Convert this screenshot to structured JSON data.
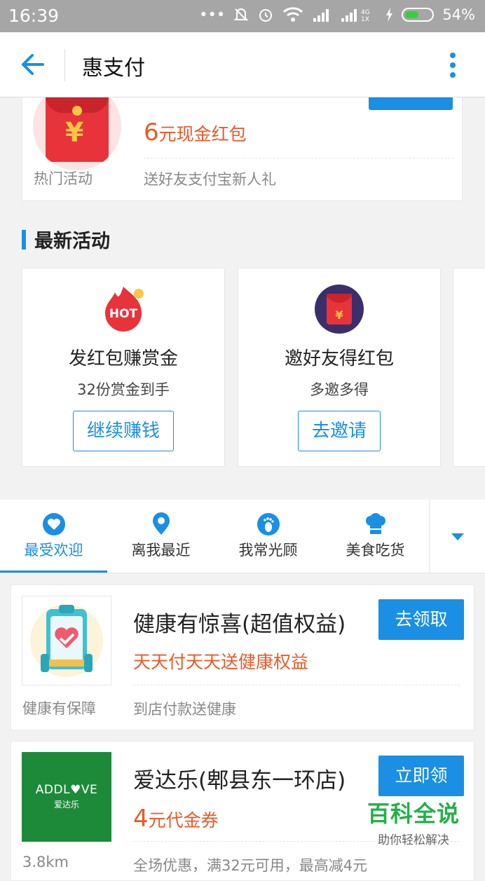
{
  "status_bar": {
    "time": "16:39",
    "battery_text": "54%",
    "battery_level": 0.54,
    "icons": [
      "more-dots-icon",
      "mute-icon",
      "alarm-icon",
      "wifi-icon",
      "signal-icon",
      "signal-4g-icon",
      "charging-icon",
      "battery-icon"
    ]
  },
  "appbar": {
    "title": "惠支付",
    "back_icon": "arrow-left-icon",
    "more_icon": "more-vertical-icon"
  },
  "hot_card": {
    "left_label": "热门活动",
    "amount_number": "6",
    "amount_text": "元现金红包",
    "description": "送好友支付宝新人礼"
  },
  "latest": {
    "section_title": "最新活动",
    "cards": [
      {
        "icon": "hot-badge-icon",
        "title": "发红包赚赏金",
        "subtitle": "32份赏金到手",
        "button": "继续赚钱"
      },
      {
        "icon": "red-envelope-icon",
        "title": "邀好友得红包",
        "subtitle": "多邀多得",
        "button": "去邀请"
      }
    ]
  },
  "tabs": {
    "items": [
      {
        "label": "最受欢迎",
        "icon": "heart-icon",
        "active": true
      },
      {
        "label": "离我最近",
        "icon": "location-pin-icon",
        "active": false
      },
      {
        "label": "我常光顾",
        "icon": "footprint-icon",
        "active": false
      },
      {
        "label": "美食吃货",
        "icon": "chef-hat-icon",
        "active": false
      }
    ],
    "expand_icon": "caret-down-icon"
  },
  "shops": [
    {
      "thumb_icon": "health-clipboard-icon",
      "title": "健康有惊喜(超值权益)",
      "action": "去领取",
      "promo": "天天付天天送健康权益",
      "left_note": "健康有保障",
      "right_note": "到店付款送健康"
    },
    {
      "thumb_text": "ADDL♥VE",
      "thumb_subtext": "爱达乐",
      "title": "爱达乐(郫县东一环店)",
      "action": "立即领",
      "promo_number": "4",
      "promo_text": "元代金券",
      "left_note": "3.8km",
      "right_note": "全场优惠，满32元可用，最高减4元"
    }
  ],
  "watermark": {
    "title": "百科全说",
    "subtitle": "助你轻松解决"
  },
  "colors": {
    "accent": "#1a8fe3",
    "promo": "#e85a28",
    "status_bar": "#a6a6a6",
    "watermark": "#23b04a"
  }
}
